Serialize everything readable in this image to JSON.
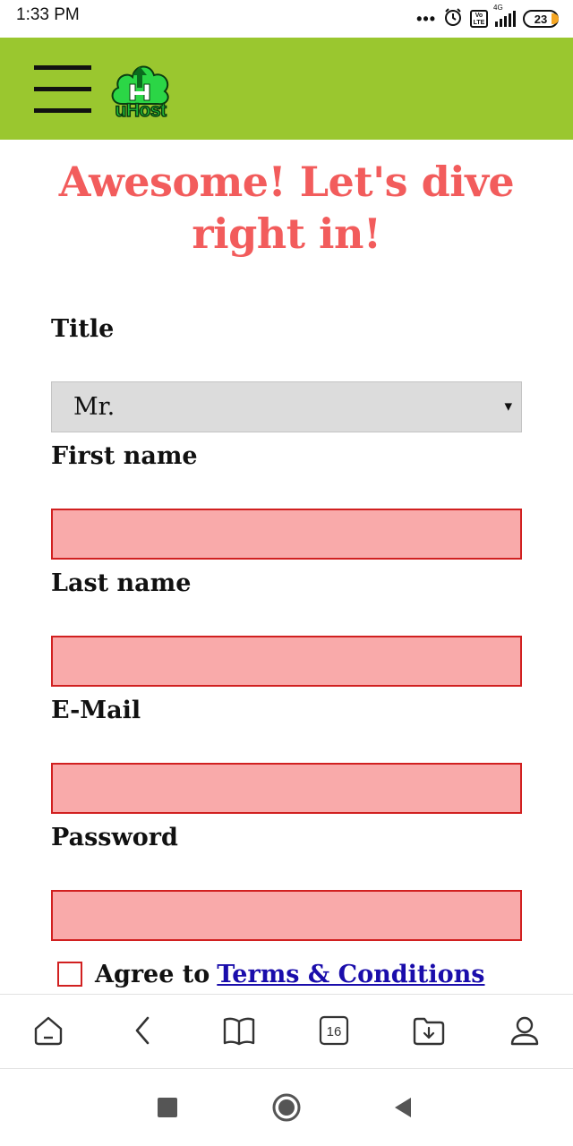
{
  "status_bar": {
    "time": "1:33 PM",
    "overflow": "•••",
    "volte": "Vo LTE",
    "network": "4G",
    "battery": "23"
  },
  "header": {
    "logo_text": "uHost",
    "brand_color": "#9ac72f"
  },
  "page": {
    "title": "Awesome! Let's dive right in!",
    "title_color": "#f25c5c"
  },
  "form": {
    "title_label": "Title",
    "title_value": "Mr.",
    "title_arrow": "▾",
    "first_name_label": "First name",
    "last_name_label": "Last name",
    "email_label": "E-Mail",
    "password_label": "Password",
    "agree_text": "Agree to",
    "terms_link": "Terms & Conditions",
    "invalid_fill_color": "#f9aaaa",
    "invalid_border_color": "#d12020"
  },
  "browser_bar": {
    "tab_count": "16",
    "icons": [
      "home-icon",
      "back-icon",
      "bookmarks-icon",
      "tabs-icon",
      "downloads-icon",
      "profile-icon"
    ]
  },
  "nav_bar": {
    "icons": [
      "recents-icon",
      "home-circle-icon",
      "back-triangle-icon"
    ]
  }
}
